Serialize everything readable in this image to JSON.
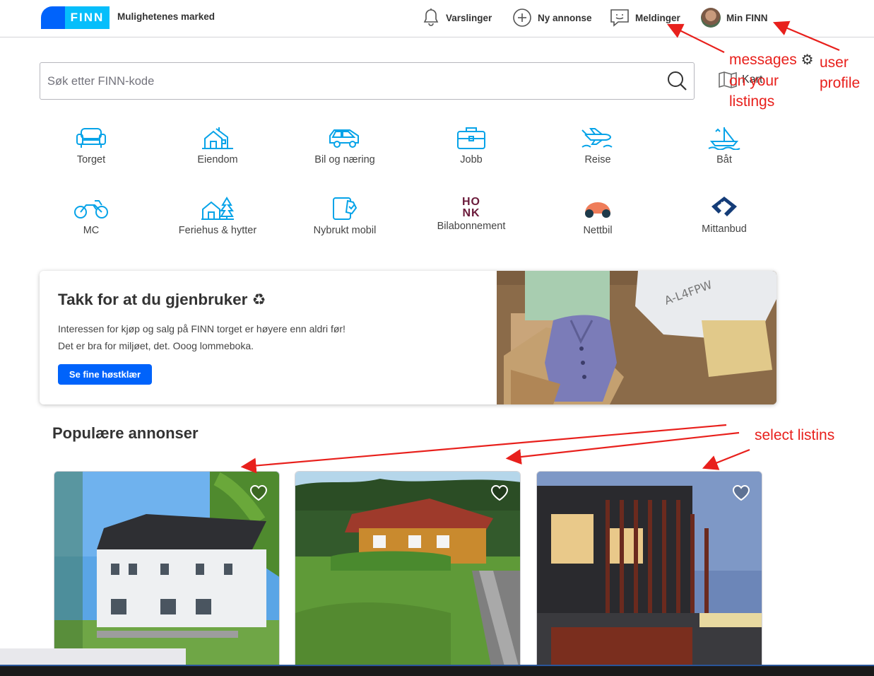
{
  "header": {
    "logo_text": "FINN",
    "tagline": "Mulighetenes marked",
    "nav": [
      {
        "label": "Varslinger",
        "icon": "bell-icon"
      },
      {
        "label": "Ny annonse",
        "icon": "plus-circle-icon"
      },
      {
        "label": "Meldinger",
        "icon": "message-icon"
      },
      {
        "label": "Min FINN",
        "icon": "avatar"
      }
    ]
  },
  "search": {
    "placeholder": "Søk etter FINN-kode",
    "map_label": "Kart"
  },
  "categories": [
    {
      "label": "Torget",
      "icon": "sofa-icon"
    },
    {
      "label": "Eiendom",
      "icon": "house-icon"
    },
    {
      "label": "Bil og næring",
      "icon": "car-icon"
    },
    {
      "label": "Jobb",
      "icon": "briefcase-icon"
    },
    {
      "label": "Reise",
      "icon": "plane-icon"
    },
    {
      "label": "Båt",
      "icon": "boat-icon"
    },
    {
      "label": "MC",
      "icon": "motorcycle-icon"
    },
    {
      "label": "Feriehus & hytter",
      "icon": "cabin-icon"
    },
    {
      "label": "Nybrukt mobil",
      "icon": "phone-icon"
    },
    {
      "label": "Bilabonnement",
      "icon": "honk-logo",
      "logo_text": "HONK"
    },
    {
      "label": "Nettbil",
      "icon": "nettbil-logo"
    },
    {
      "label": "Mittanbud",
      "icon": "mittanbud-logo"
    }
  ],
  "promo": {
    "title": "Takk for at du gjenbruker",
    "line1": "Interessen for kjøp og salg på FINN torget er høyere enn aldri før!",
    "line2": "Det er bra for miljøet, det. Ooog lommeboka.",
    "button": "Se fine høstklær",
    "tag_text": "A-L4FPW"
  },
  "popular": {
    "title": "Populære annonser",
    "listings": [
      {
        "alt": "white-house-photo"
      },
      {
        "alt": "yellow-cabin-photo"
      },
      {
        "alt": "modern-house-photo"
      }
    ]
  },
  "annotations": {
    "messages_line1": "messages",
    "messages_line2": "on your",
    "messages_line3": "listings",
    "user_line1": "user",
    "user_line2": "profile",
    "select": "select listins"
  },
  "colors": {
    "brand_blue": "#0063fb",
    "brand_cyan": "#06befb",
    "icon_blue": "#06a3e8",
    "annotation_red": "#e8201c"
  }
}
